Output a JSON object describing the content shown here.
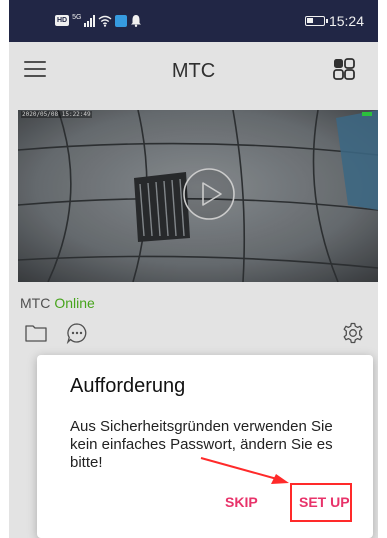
{
  "status_bar": {
    "hd_badge": "HD",
    "network": "5G",
    "time": "15:24"
  },
  "app_bar": {
    "title": "MTC"
  },
  "camera": {
    "timestamp": "2020/05/08 15:22:49",
    "name": "MTC",
    "status": "Online",
    "status_color": "#4caf1e"
  },
  "dialog": {
    "title": "Aufforderung",
    "message": "Aus Sicherheitsgründen verwenden Sie kein einfaches Passwort, ändern Sie es bitte!",
    "skip_label": "SKIP",
    "setup_label": "SET UP",
    "accent_color": "#e8336a",
    "highlight_color": "#ff2a2a"
  },
  "colors": {
    "status_bar_bg": "#24294a",
    "app_bg": "#f2f2f2"
  }
}
